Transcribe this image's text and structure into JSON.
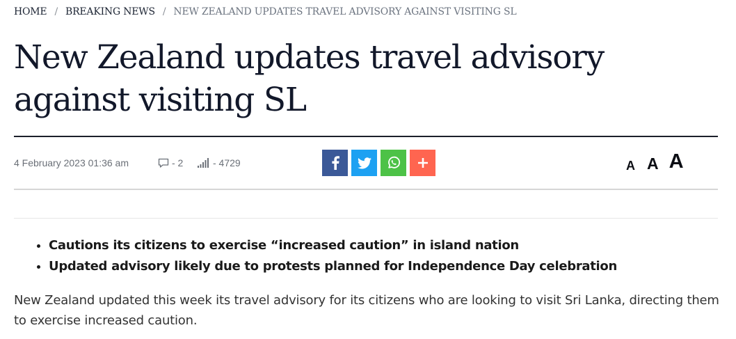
{
  "breadcrumb": {
    "home": "HOME",
    "section": "BREAKING NEWS",
    "current": "NEW ZEALAND UPDATES TRAVEL ADVISORY AGAINST VISITING SL",
    "separator": "/"
  },
  "article": {
    "title": "New Zealand updates travel advisory against visiting SL",
    "date": "4 February 2023 01:36 am",
    "comments": "- 2",
    "views": "- 4729",
    "bullets": [
      "Cautions its citizens to exercise “increased caution” in island nation",
      "Updated advisory likely due to protests planned for Independence Day celebration"
    ],
    "body": "New Zealand updated this week its travel advisory for its citizens who are looking to visit Sri Lanka, directing them to exercise increased caution."
  },
  "share": [
    {
      "name": "facebook",
      "icon": "facebook-icon",
      "color": "#3b5998"
    },
    {
      "name": "twitter",
      "icon": "twitter-icon",
      "color": "#1da1f2"
    },
    {
      "name": "whatsapp",
      "icon": "whatsapp-icon",
      "color": "#4dc247"
    },
    {
      "name": "more",
      "icon": "plus-icon",
      "color": "#ff6550"
    }
  ],
  "font_size_controls": {
    "small": "A",
    "medium": "A",
    "large": "A"
  },
  "meta_icons": {
    "comments": "comment-icon",
    "views": "signal-bars-icon"
  }
}
